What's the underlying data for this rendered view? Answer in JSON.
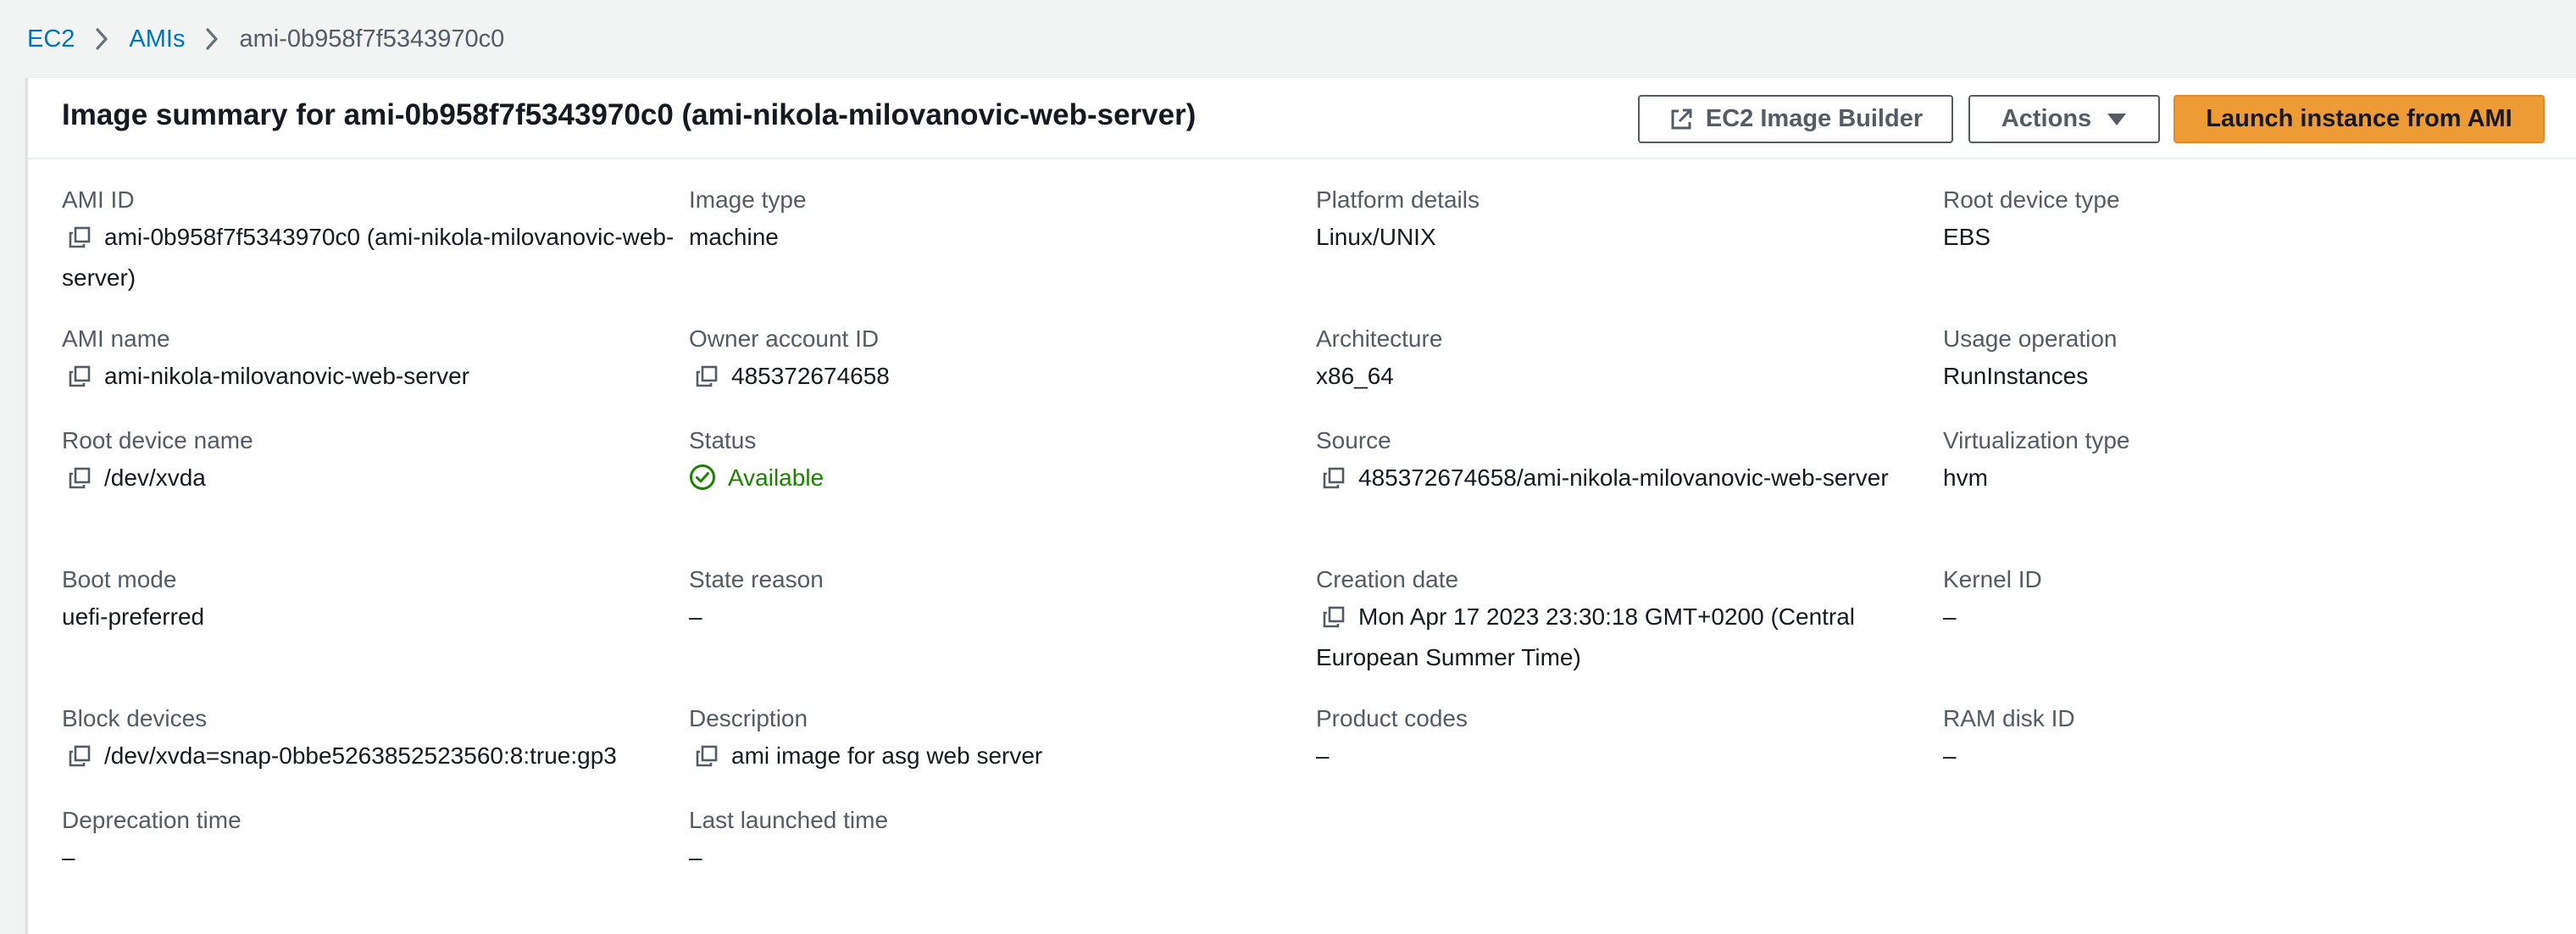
{
  "breadcrumb": {
    "items": [
      "EC2",
      "AMIs"
    ],
    "current": "ami-0b958f7f5343970c0"
  },
  "header": {
    "title": "Image summary for ami-0b958f7f5343970c0 (ami-nikola-milovanovic-web-server)",
    "image_builder_label": "EC2 Image Builder",
    "actions_label": "Actions",
    "launch_label": "Launch instance from AMI"
  },
  "fields": {
    "ami_id": {
      "label": "AMI ID",
      "value": "ami-0b958f7f5343970c0 (ami-nikola-milovanovic-web-server)"
    },
    "image_type": {
      "label": "Image type",
      "value": "machine"
    },
    "platform_details": {
      "label": "Platform details",
      "value": "Linux/UNIX"
    },
    "root_device_type": {
      "label": "Root device type",
      "value": "EBS"
    },
    "ami_name": {
      "label": "AMI name",
      "value": "ami-nikola-milovanovic-web-server"
    },
    "owner_account_id": {
      "label": "Owner account ID",
      "value": "485372674658"
    },
    "architecture": {
      "label": "Architecture",
      "value": "x86_64"
    },
    "usage_operation": {
      "label": "Usage operation",
      "value": "RunInstances"
    },
    "root_device_name": {
      "label": "Root device name",
      "value": "/dev/xvda"
    },
    "status": {
      "label": "Status",
      "value": "Available"
    },
    "source": {
      "label": "Source",
      "value": "485372674658/ami-nikola-milovanovic-web-server"
    },
    "virtualization_type": {
      "label": "Virtualization type",
      "value": "hvm"
    },
    "boot_mode": {
      "label": "Boot mode",
      "value": "uefi-preferred"
    },
    "state_reason": {
      "label": "State reason",
      "value": "–"
    },
    "creation_date": {
      "label": "Creation date",
      "value": "Mon Apr 17 2023 23:30:18 GMT+0200 (Central European Summer Time)"
    },
    "kernel_id": {
      "label": "Kernel ID",
      "value": "–"
    },
    "block_devices": {
      "label": "Block devices",
      "value": "/dev/xvda=snap-0bbe5263852523560:8:true:gp3"
    },
    "description": {
      "label": "Description",
      "value": "ami image for asg web server"
    },
    "product_codes": {
      "label": "Product codes",
      "value": "–"
    },
    "ram_disk_id": {
      "label": "RAM disk ID",
      "value": "–"
    },
    "deprecation_time": {
      "label": "Deprecation time",
      "value": "–"
    },
    "last_launched_time": {
      "label": "Last launched time",
      "value": "–"
    }
  },
  "colors": {
    "link": "#0073bb",
    "primary_button": "#ec9b35",
    "status_available": "#1d8102"
  },
  "icons": {
    "copy": "copy-icon",
    "external": "external-link-icon",
    "caret": "caret-down-icon",
    "status": "check-circle-icon",
    "breadcrumb_separator": "chevron-right-icon"
  }
}
